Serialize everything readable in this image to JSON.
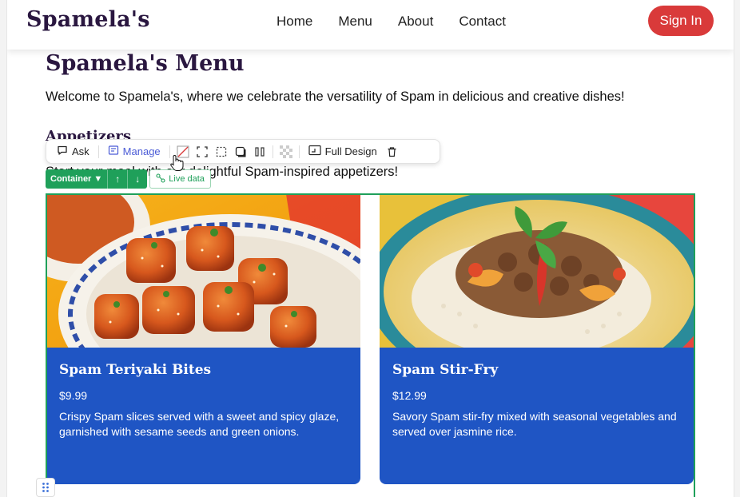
{
  "header": {
    "logo": "Spamela's",
    "nav": [
      "Home",
      "Menu",
      "About",
      "Contact"
    ],
    "signin": "Sign In"
  },
  "main": {
    "title": "Spamela's Menu",
    "intro": "Welcome to Spamela's, where we celebrate the versatility of Spam in delicious and creative dishes!",
    "section_title": "Appetizers",
    "section_intro": "Start your meal with our delightful Spam-inspired appetizers!"
  },
  "editor": {
    "toolbar": {
      "ask": "Ask",
      "manage": "Manage",
      "full_design": "Full Design"
    },
    "selection_label": "Container ▼",
    "live_data": "Live data"
  },
  "cards": [
    {
      "name": "Spam Teriyaki Bites",
      "price": "$9.99",
      "description": "Crispy Spam slices served with a sweet and spicy glaze, garnished with sesame seeds and green onions."
    },
    {
      "name": "Spam Stir-Fry",
      "price": "$12.99",
      "description": "Savory Spam stir-fry mixed with seasonal vegetables and served over jasmine rice."
    }
  ],
  "colors": {
    "brand": "#2a1740",
    "signin": "#d93a3a",
    "card": "#1f55c4",
    "selection": "#1fa05a",
    "manage": "#4a5bd6"
  }
}
